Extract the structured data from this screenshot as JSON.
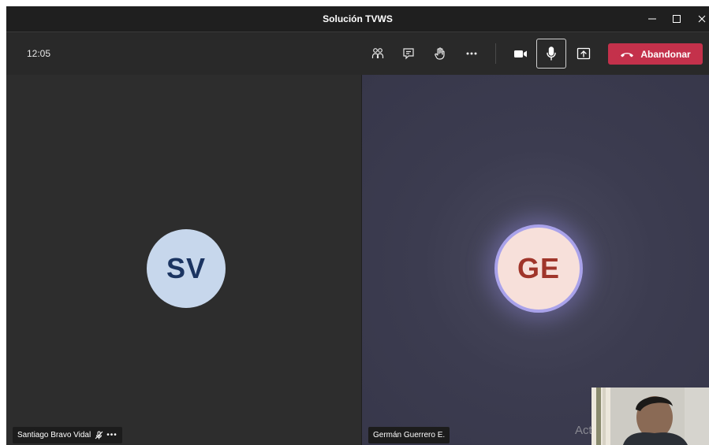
{
  "window": {
    "title": "Solución TVWS",
    "controls": [
      "minimize-icon",
      "maximize-icon",
      "close-icon"
    ]
  },
  "toolbar": {
    "time": "12:05",
    "buttons": [
      "participants-icon",
      "chat-icon",
      "raise-hand-icon",
      "more-options-icon",
      "camera-icon",
      "microphone-icon",
      "share-screen-icon"
    ],
    "leave_label": "Abandonar",
    "leave_color": "#c4314b"
  },
  "participants": [
    {
      "initials": "SV",
      "name": "Santiago Bravo Vidal",
      "muted": true,
      "avatar_bg": "#c7d7ec",
      "avatar_fg": "#1b3461"
    },
    {
      "initials": "GE",
      "name": "Germán Guerrero E.",
      "speaking": true,
      "avatar_bg": "#f7e0da",
      "avatar_fg": "#a0352a",
      "ring_color": "#a9a2ea"
    }
  ],
  "self_view": {
    "visible": true
  },
  "watermark": {
    "text": "Activar Windows"
  }
}
